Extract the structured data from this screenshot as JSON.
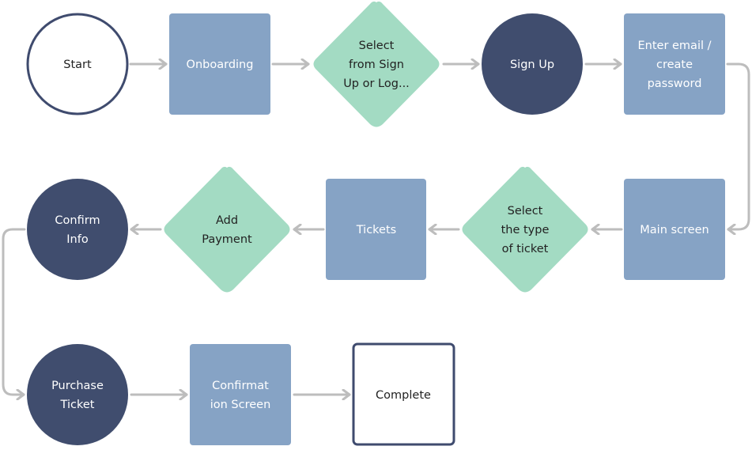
{
  "colors": {
    "dark_node": "#404d6e",
    "process_node": "#86a3c5",
    "decision_node": "#a3dbc3",
    "edge": "#bdbdbd",
    "outline": "#3f4b6e"
  },
  "nodes": {
    "start": {
      "shape": "circle-outline",
      "lines": [
        "Start"
      ]
    },
    "onboarding": {
      "shape": "rect",
      "lines": [
        "Onboarding"
      ]
    },
    "select_signup": {
      "shape": "diamond",
      "lines": [
        "Select",
        "from Sign",
        "Up or Log..."
      ]
    },
    "signup": {
      "shape": "circle",
      "lines": [
        "Sign Up"
      ]
    },
    "enter_email": {
      "shape": "rect",
      "lines": [
        "Enter email /",
        "create",
        "password"
      ]
    },
    "main_screen": {
      "shape": "rect",
      "lines": [
        "Main screen"
      ]
    },
    "select_ticket": {
      "shape": "diamond",
      "lines": [
        "Select",
        "the type",
        "of ticket"
      ]
    },
    "tickets": {
      "shape": "rect",
      "lines": [
        "Tickets"
      ]
    },
    "add_payment": {
      "shape": "diamond",
      "lines": [
        "Add",
        "Payment"
      ]
    },
    "confirm_info": {
      "shape": "circle",
      "lines": [
        "Confirm",
        "Info"
      ]
    },
    "purchase_ticket": {
      "shape": "circle",
      "lines": [
        "Purchase",
        "Ticket"
      ]
    },
    "confirmation_screen": {
      "shape": "rect",
      "lines": [
        "Confirmat",
        "ion Screen"
      ]
    },
    "complete": {
      "shape": "rect-outline",
      "lines": [
        "Complete"
      ]
    }
  },
  "edges": [
    [
      "start",
      "onboarding"
    ],
    [
      "onboarding",
      "select_signup"
    ],
    [
      "select_signup",
      "signup"
    ],
    [
      "signup",
      "enter_email"
    ],
    [
      "enter_email",
      "main_screen"
    ],
    [
      "main_screen",
      "select_ticket"
    ],
    [
      "select_ticket",
      "tickets"
    ],
    [
      "tickets",
      "add_payment"
    ],
    [
      "add_payment",
      "confirm_info"
    ],
    [
      "confirm_info",
      "purchase_ticket"
    ],
    [
      "purchase_ticket",
      "confirmation_screen"
    ],
    [
      "confirmation_screen",
      "complete"
    ]
  ]
}
